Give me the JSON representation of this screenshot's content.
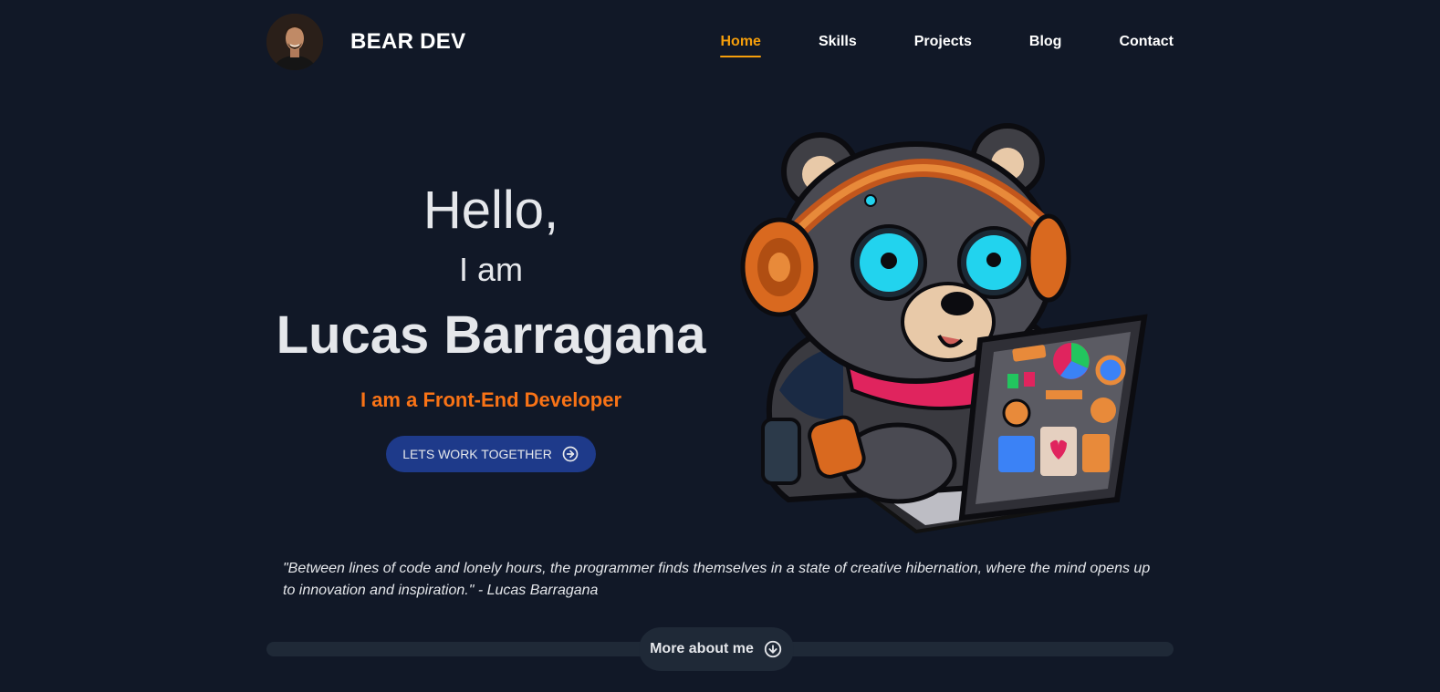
{
  "header": {
    "brand": "BEAR DEV",
    "nav": [
      {
        "label": "Home",
        "active": true
      },
      {
        "label": "Skills",
        "active": false
      },
      {
        "label": "Projects",
        "active": false
      },
      {
        "label": "Blog",
        "active": false
      },
      {
        "label": "Contact",
        "active": false
      }
    ]
  },
  "hero": {
    "greeting": "Hello,",
    "intro": "I am",
    "name": "Lucas Barragana",
    "role": "I am a Front-End Developer",
    "cta_label": "LETS WORK TOGETHER",
    "cta_icon": "arrow-right-circle-icon"
  },
  "quote": "\"Between lines of code and lonely hours, the programmer finds themselves in a state of creative hibernation, where the mind opens up to innovation and inspiration.\" - Lucas Barragana",
  "more": {
    "label": "More about me",
    "icon": "arrow-down-circle-icon"
  },
  "colors": {
    "background": "#111827",
    "accent": "#f59e0b",
    "role": "#f97316",
    "cta": "#1e3a8a",
    "surface": "#1f2937"
  }
}
